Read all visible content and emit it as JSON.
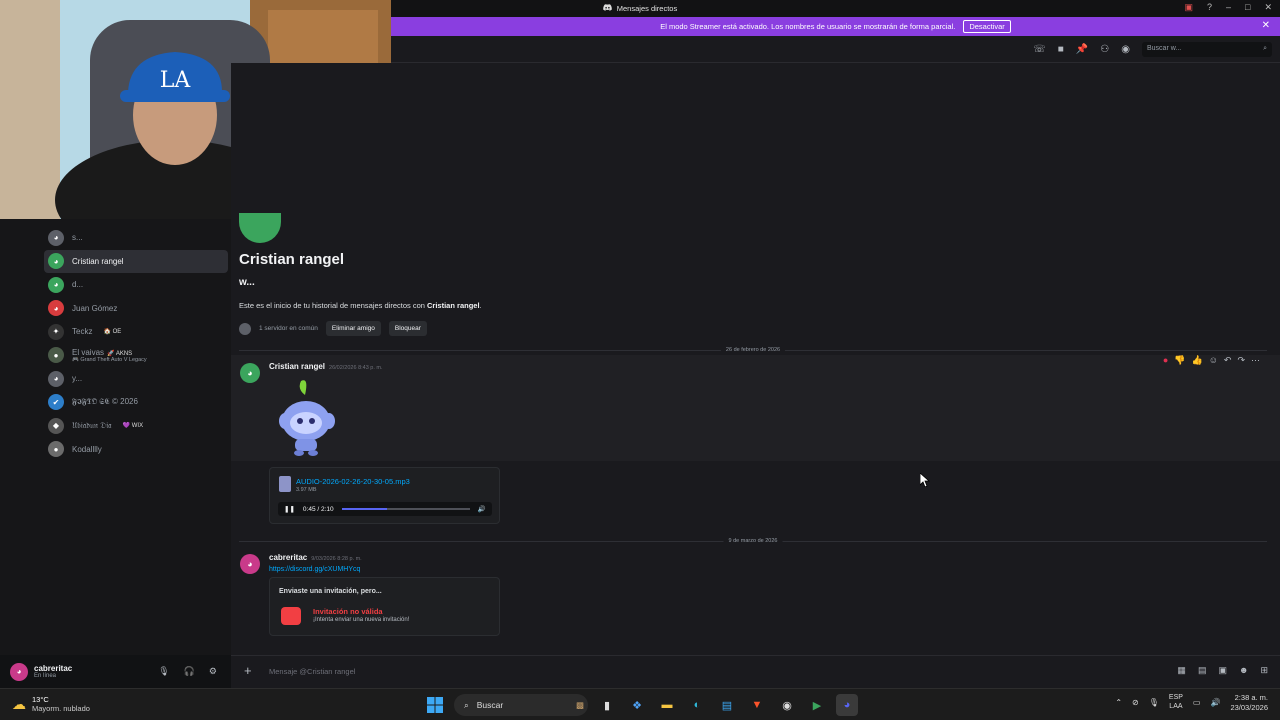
{
  "window": {
    "title": "Mensajes directos"
  },
  "streamer_banner": {
    "text": "El modo Streamer está activado. Los nombres de usuario se mostrarán de forma parcial.",
    "button": "Desactivar"
  },
  "search": {
    "placeholder": "Buscar w..."
  },
  "dms": [
    {
      "name": "s...",
      "avatar": "discord-gray",
      "active": false
    },
    {
      "name": "Cristian rangel",
      "avatar": "discord-green",
      "active": true
    },
    {
      "name": "d...",
      "avatar": "discord-green",
      "active": false
    },
    {
      "name": "Juan Gómez",
      "avatar": "discord-red",
      "active": false
    },
    {
      "name": "Teckz",
      "badge": "🏠 OE",
      "avatar": "photo",
      "active": false
    },
    {
      "name": "El vaivas",
      "badge": "🚀 AKNS",
      "sub": "🎮 Grand Theft Auto V Legacy",
      "avatar": "photo",
      "active": false
    },
    {
      "name": "y...",
      "avatar": "discord-gray",
      "active": false
    },
    {
      "name": "𝕱𝕴𝕱𝕿𝕺 𝕾𝕮 © 2026",
      "avatar": "photo",
      "active": false
    },
    {
      "name": "𝔘𝔟𝔦𝔞𝔡𝔲𝔫 𝔇𝔦𝔞",
      "badge": "💜 WIX",
      "avatar": "photo",
      "active": false
    },
    {
      "name": "Kodalllly",
      "avatar": "photo",
      "active": false
    }
  ],
  "user": {
    "name": "cabreritac",
    "status": "En línea"
  },
  "channel": {
    "name": "Cristian rangel",
    "alias": "w...",
    "intro_prefix": "Este es el inicio de tu historial de mensajes directos con ",
    "intro_name": "Cristian rangel",
    "intro_suffix": ".",
    "mutual": "1 servidor en común",
    "remove_friend": "Eliminar amigo",
    "block": "Bloquear"
  },
  "dividers": [
    "26 de febrero de 2026",
    "9 de marzo de 2026"
  ],
  "messages": [
    {
      "author": "Cristian rangel",
      "timestamp": "26/02/2026 8:43 p. m.",
      "sticker": "wumpus-sticker",
      "attachment": {
        "filename": "AUDIO-2026-02-26-20-30-05.mp3",
        "size": "3.97 MB",
        "time": "0:45 / 2:10",
        "progress": 0.35
      }
    },
    {
      "author": "cabreritac",
      "timestamp": "9/03/2026 8:28 p. m.",
      "link": "https://discord.gg/cXUMHYcq",
      "invite": {
        "heading": "Enviaste una invitación, pero...",
        "title": "Invitación no válida",
        "subtitle": "¡Intenta enviar una nueva invitación!"
      }
    }
  ],
  "composer": {
    "placeholder": "Mensaje @Cristian rangel"
  },
  "taskbar": {
    "weather_temp": "13°C",
    "weather_desc": "Mayorm. nublado",
    "search_label": "Buscar",
    "lang_top": "ESP",
    "lang_bottom": "LAA",
    "time": "2:38 a. m.",
    "date": "23/03/2026"
  },
  "colors": {
    "accent": "#5865f2",
    "streamer": "#8a3ee0",
    "danger": "#f23f43",
    "online": "#23a55a"
  }
}
